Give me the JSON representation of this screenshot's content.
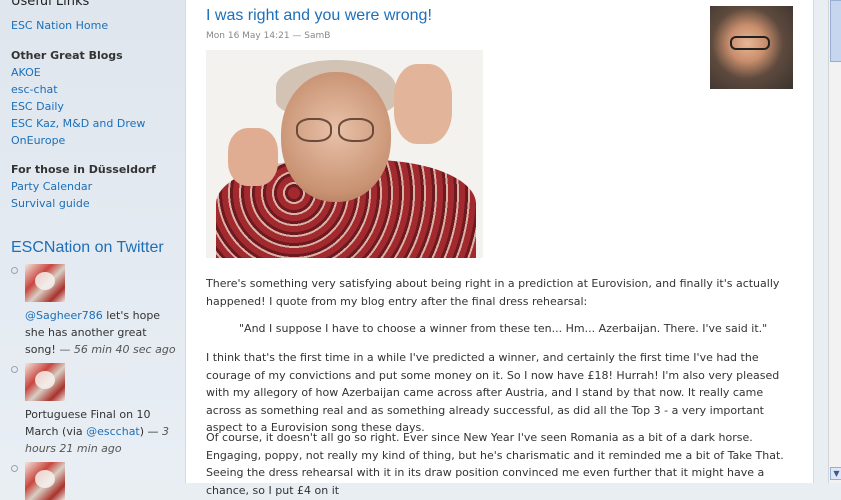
{
  "sidebar": {
    "useful_links_heading": "Useful Links",
    "useful_links": [
      "ESC Nation Home"
    ],
    "other_blogs_heading": "Other Great Blogs",
    "other_blogs": [
      "AKOE",
      "esc-chat",
      "ESC Daily",
      "ESC Kaz, M&D and Drew",
      "OnEurope"
    ],
    "dusseldorf_heading": "For those in Düsseldorf",
    "dusseldorf_links": [
      "Party Calendar",
      "Survival guide"
    ],
    "twitter_heading": "ESCNation on Twitter",
    "tweets": [
      {
        "lines": [
          "@Sagheer786 let's hope",
          "she has another great"
        ],
        "tail": "song!",
        "time": "— 56 min 40 sec ago",
        "mention": "@Sagheer786"
      },
      {
        "lines": [
          "Portuguese Final on 10"
        ],
        "via_prefix": "March (via ",
        "via_handle": "@escchat",
        "via_suffix": ") —",
        "time_a": "3",
        "time_b": "hours 21 min ago"
      }
    ]
  },
  "post": {
    "title": "I was right and you were wrong!",
    "meta": "Mon 16 May 14:21 — SamB",
    "paragraph1": "There's something very satisfying about being right in a prediction at Eurovision, and finally it's actually happened! I quote from my blog entry after the final dress rehearsal:",
    "quote": "\"And I suppose I have to choose a winner from these ten... Hm... Azerbaijan. There. I've said it.\"",
    "paragraph2": "I think that's the first time in a while I've predicted a winner, and certainly the first time I've had the courage of my convictions and put some money on it. So I now have £18! Hurrah! I'm also very pleased with my allegory of how Azerbaijan came across after Austria, and I stand by that now. It really came across as something real and as something already successful, as did all the Top 3 - a very important aspect to a Eurovision song these days.",
    "paragraph3": "Of course, it doesn't all go so right. Ever since New Year I've seen Romania as a bit of a dark horse. Engaging, poppy, not really my kind of thing, but he's charismatic and it reminded me a bit of Take That. Seeing the dress rehearsal with it in its draw position convinced me even further that it might have a chance, so I put £4 on it"
  },
  "scrollbar": {
    "down_arrow": "▼"
  }
}
